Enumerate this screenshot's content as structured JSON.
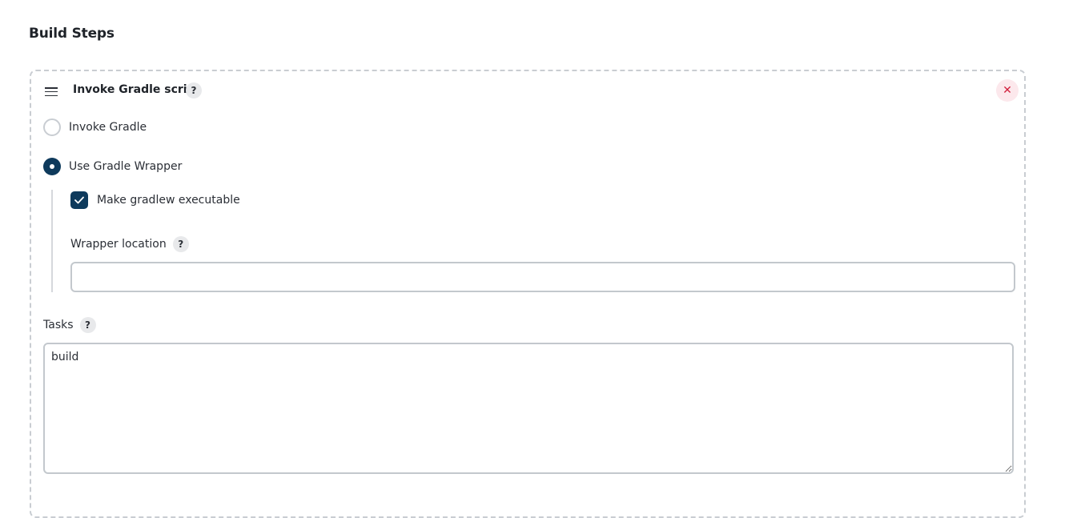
{
  "section": {
    "title": "Build Steps"
  },
  "step": {
    "title": "Invoke Gradle script",
    "help_glyph": "?",
    "close_glyph": "✕",
    "accent_color": "#0e3a5c",
    "close_color": "#d21f3c",
    "options": {
      "invoke_gradle": {
        "label": "Invoke Gradle",
        "selected": false
      },
      "use_wrapper": {
        "label": "Use Gradle Wrapper",
        "selected": true
      }
    },
    "wrapper": {
      "make_executable_label": "Make gradlew executable",
      "make_executable_checked": true,
      "location_label": "Wrapper location",
      "location_value": ""
    },
    "tasks": {
      "label": "Tasks",
      "value": "build"
    }
  }
}
